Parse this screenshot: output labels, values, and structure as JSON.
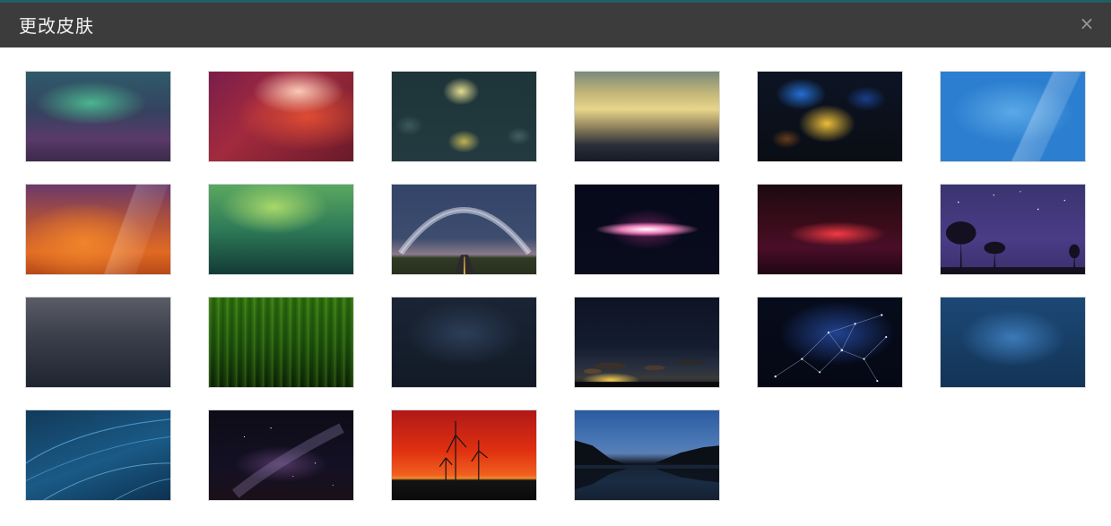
{
  "dialog": {
    "title": "更改皮肤",
    "close_label": "×"
  },
  "skins": [
    {
      "name": "teal-purple-blur"
    },
    {
      "name": "red-orange-blur"
    },
    {
      "name": "teal-yellow-bokeh"
    },
    {
      "name": "golden-horizon-blur"
    },
    {
      "name": "blue-orange-bokeh"
    },
    {
      "name": "blue-glossy"
    },
    {
      "name": "orange-purple-glossy"
    },
    {
      "name": "green-gradient"
    },
    {
      "name": "milky-way-road"
    },
    {
      "name": "pink-galaxy"
    },
    {
      "name": "red-nebula"
    },
    {
      "name": "purple-night-trees"
    },
    {
      "name": "dark-gray-gradient"
    },
    {
      "name": "green-curtain"
    },
    {
      "name": "dark-blue-gradient"
    },
    {
      "name": "sunset-clouds"
    },
    {
      "name": "blue-network"
    },
    {
      "name": "blue-gradient"
    },
    {
      "name": "blue-curves"
    },
    {
      "name": "night-sky-stars"
    },
    {
      "name": "red-sunset-windmills"
    },
    {
      "name": "blue-lake-dusk"
    }
  ],
  "colors": {
    "titlebar": "#3c3c3c",
    "title_text": "#f2f2f2",
    "background": "#ffffff"
  }
}
